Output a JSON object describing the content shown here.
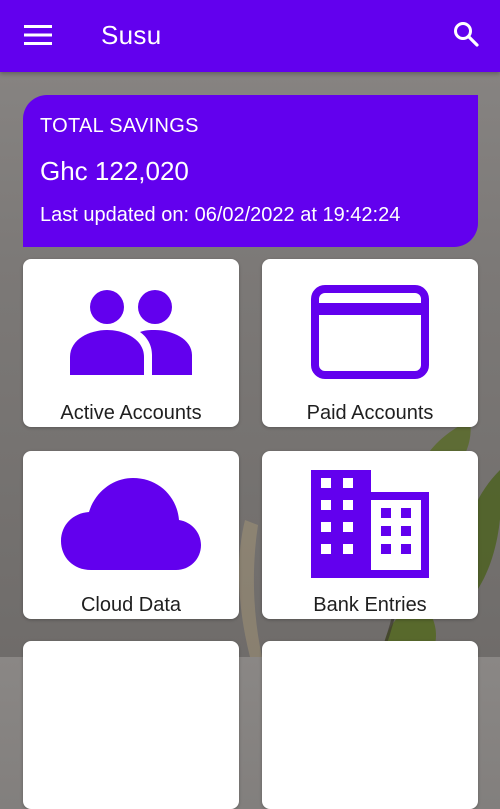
{
  "app": {
    "title": "Susu",
    "accent_color": "#6200ee",
    "menu_icon": "hamburger-menu-icon",
    "search_icon": "search-icon"
  },
  "savings": {
    "label": "TOTAL SAVINGS",
    "amount": "Ghc 122,020",
    "last_updated": "Last updated on: 06/02/2022 at 19:42:24"
  },
  "tiles": [
    {
      "label": "Active Accounts",
      "icon": "people-icon"
    },
    {
      "label": "Paid Accounts",
      "icon": "card-icon"
    },
    {
      "label": "Cloud Data",
      "icon": "cloud-icon"
    },
    {
      "label": "Bank Entries",
      "icon": "building-icon"
    },
    {
      "label": "",
      "icon": ""
    },
    {
      "label": "",
      "icon": ""
    }
  ]
}
